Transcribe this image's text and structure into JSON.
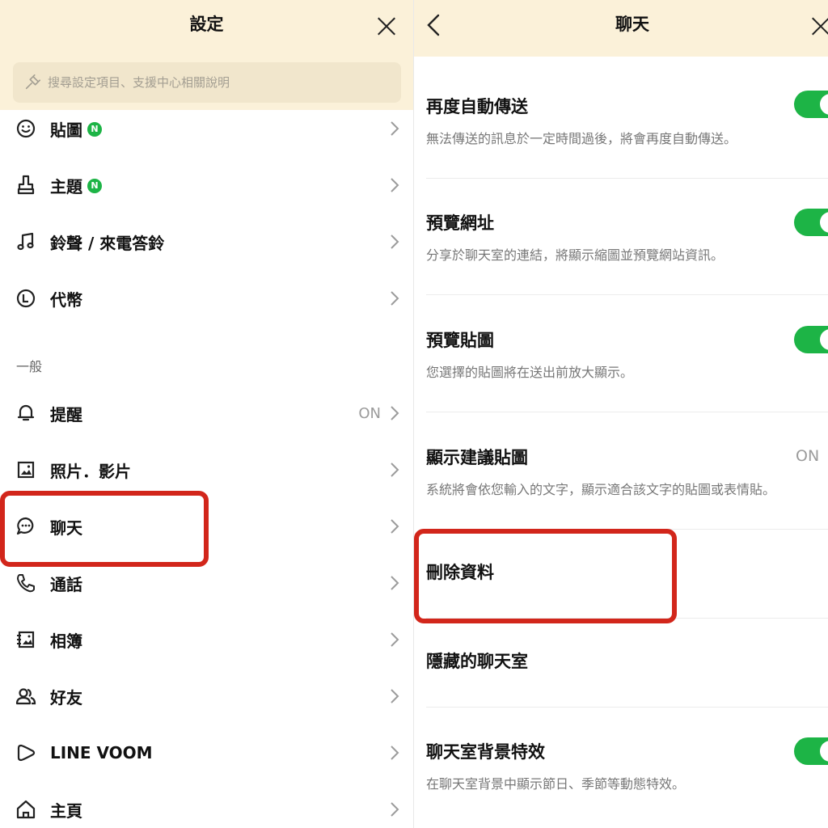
{
  "left": {
    "title": "設定",
    "search": {
      "placeholder": "搜尋設定項目、支援中心相關說明"
    },
    "items": [
      {
        "label": "貼圖",
        "badge": "N"
      },
      {
        "label": "主題",
        "badge": "N"
      },
      {
        "label": "鈴聲 / 來電答鈴"
      },
      {
        "label": "代幣"
      },
      {
        "label": "提醒",
        "value": "ON"
      },
      {
        "label": "照片．影片"
      },
      {
        "label": "聊天"
      },
      {
        "label": "通話"
      },
      {
        "label": "相簿"
      },
      {
        "label": "好友"
      },
      {
        "label": "LINE VOOM"
      },
      {
        "label": "主頁"
      }
    ],
    "section_general": "一般"
  },
  "right": {
    "title": "聊天",
    "settings": [
      {
        "title": "再度自動傳送",
        "desc": "無法傳送的訊息於一定時間過後，將會再度自動傳送。",
        "toggle": "on"
      },
      {
        "title": "預覽網址",
        "desc": "分享於聊天室的連結，將顯示縮圖並預覽網站資訊。",
        "toggle": "on"
      },
      {
        "title": "預覽貼圖",
        "desc": "您選擇的貼圖將在送出前放大顯示。",
        "toggle": "on"
      },
      {
        "title": "顯示建議貼圖",
        "desc": "系統將會依您輸入的文字，顯示適合該文字的貼圖或表情貼。",
        "value": "ON"
      },
      {
        "title": "刪除資料"
      },
      {
        "title": "隱藏的聊天室"
      },
      {
        "title": "聊天室背景特效",
        "desc": "在聊天室背景中顯示節日、季節等動態特效。",
        "toggle": "on"
      }
    ]
  },
  "colors": {
    "accent_green": "#1db446",
    "header_bg": "#fbf1d9",
    "highlight_red": "#d2261b"
  }
}
